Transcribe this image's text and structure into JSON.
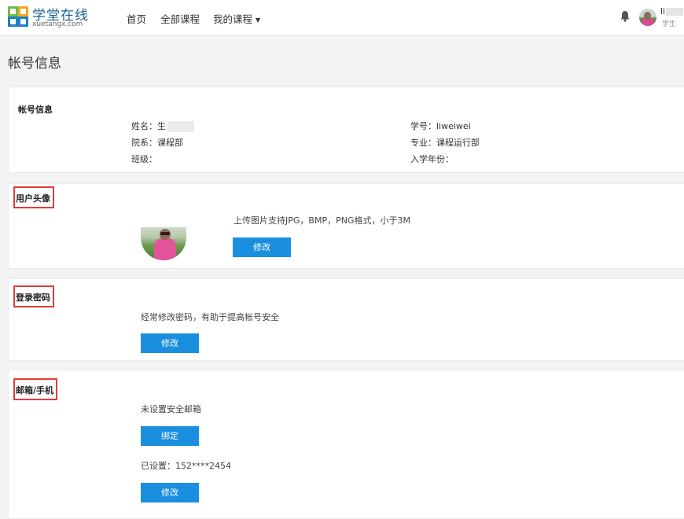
{
  "header": {
    "logo_title": "学堂在线",
    "logo_subtitle": "xuetangx.com",
    "nav": [
      "首页",
      "全部课程",
      "我的课程"
    ],
    "user_name": "li",
    "user_role": "学生"
  },
  "page": {
    "title": "帐号信息"
  },
  "account": {
    "title": "帐号信息",
    "name_label": "姓名：",
    "name_value": "生",
    "student_no": "学号：liweiwei",
    "department": "院系：课程部",
    "major": "专业：课程运行部",
    "class_label": "班级：",
    "enroll_year": "入学年份："
  },
  "avatar": {
    "title": "用户头像",
    "hint": "上传图片支持JPG，BMP，PNG格式，小于3M",
    "button": "修改"
  },
  "password": {
    "title": "登录密码",
    "hint": "经常修改密码，有助于提高帐号安全",
    "button": "修改"
  },
  "contact": {
    "title": "邮箱/手机",
    "email_status": "未设置安全邮箱",
    "bind_button": "绑定",
    "phone_status": "已设置：152****2454",
    "edit_button": "修改"
  },
  "colors": {
    "brand_blue": "#1a8fe0",
    "highlight_red": "#e23b3b",
    "logo_green": "#6cbe45",
    "logo_orange": "#f6a623",
    "logo_blue": "#1f7fc8"
  }
}
